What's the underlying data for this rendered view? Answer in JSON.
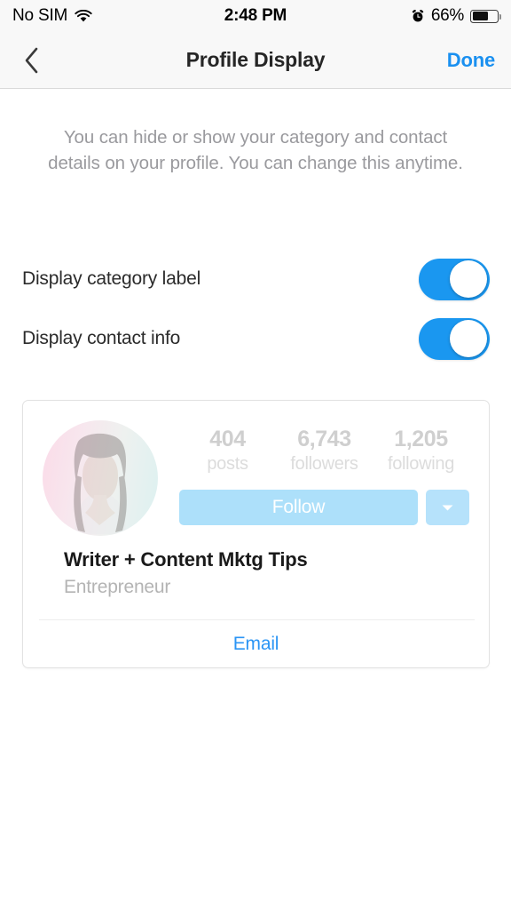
{
  "status_bar": {
    "carrier": "No SIM",
    "wifi_icon": "wifi-icon",
    "time": "2:48 PM",
    "alarm_icon": "alarm-clock-icon",
    "battery_percent": "66%",
    "battery_level": 66,
    "battery_icon": "battery-icon"
  },
  "nav": {
    "back_icon": "chevron-left-icon",
    "title": "Profile Display",
    "done_label": "Done"
  },
  "description": "You can hide or show your category and contact details on your profile. You can change this anytime.",
  "settings": [
    {
      "label": "Display category label",
      "enabled": true
    },
    {
      "label": "Display contact info",
      "enabled": true
    }
  ],
  "preview": {
    "avatar_icon": "profile-avatar",
    "stats": [
      {
        "value": "404",
        "label": "posts"
      },
      {
        "value": "6,743",
        "label": "followers"
      },
      {
        "value": "1,205",
        "label": "following"
      }
    ],
    "follow_label": "Follow",
    "dropdown_icon": "chevron-down-icon",
    "name": "Writer + Content Mktg Tips",
    "category": "Entrepreneur",
    "email_label": "Email"
  },
  "colors": {
    "accent_blue": "#1a90f0",
    "toggle_on": "#1a97f0",
    "follow_button": "#ade0fa",
    "email_link": "#2b95f5",
    "nav_background": "#f8f8f8"
  }
}
